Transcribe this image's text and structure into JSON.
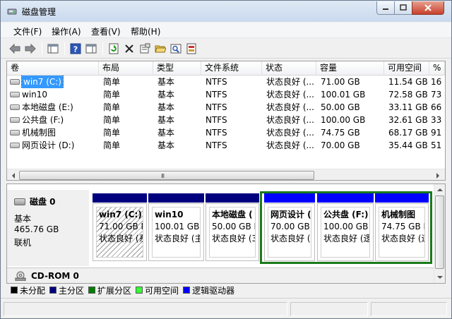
{
  "window": {
    "title": "磁盘管理"
  },
  "menu": [
    "文件(F)",
    "操作(A)",
    "查看(V)",
    "帮助(H)"
  ],
  "toolbar": {
    "icons": [
      "back-arrow-icon",
      "forward-arrow-icon",
      "console-tree-icon",
      "help-icon",
      "properties-panel-icon",
      "refresh-icon",
      "delete-icon",
      "properties-icon",
      "open-folder-icon",
      "search-icon",
      "rescan-disk-icon"
    ]
  },
  "columns": [
    "卷",
    "布局",
    "类型",
    "文件系统",
    "状态",
    "容量",
    "可用空间",
    "%"
  ],
  "volumes": [
    {
      "name": "win7 (C:)",
      "layout": "简单",
      "type": "基本",
      "fs": "NTFS",
      "status": "状态良好 (...",
      "capacity": "71.00 GB",
      "free": "11.54 GB",
      "pct": "16",
      "selected": true
    },
    {
      "name": "win10",
      "layout": "简单",
      "type": "基本",
      "fs": "NTFS",
      "status": "状态良好 (...",
      "capacity": "100.01 GB",
      "free": "72.58 GB",
      "pct": "73"
    },
    {
      "name": "本地磁盘 (E:)",
      "layout": "简单",
      "type": "基本",
      "fs": "NTFS",
      "status": "状态良好 (...",
      "capacity": "50.00 GB",
      "free": "33.11 GB",
      "pct": "66"
    },
    {
      "name": "公共盘 (F:)",
      "layout": "简单",
      "type": "基本",
      "fs": "NTFS",
      "status": "状态良好 (...",
      "capacity": "100.00 GB",
      "free": "32.61 GB",
      "pct": "33"
    },
    {
      "name": "机械制图",
      "layout": "简单",
      "type": "基本",
      "fs": "NTFS",
      "status": "状态良好 (...",
      "capacity": "74.75 GB",
      "free": "68.17 GB",
      "pct": "91"
    },
    {
      "name": "网页设计 (D:)",
      "layout": "简单",
      "type": "基本",
      "fs": "NTFS",
      "status": "状态良好 (...",
      "capacity": "70.00 GB",
      "free": "35.44 GB",
      "pct": "51"
    }
  ],
  "scroll": {
    "grip": "III"
  },
  "disk0": {
    "title": "磁盘 0",
    "kind": "基本",
    "size": "465.76 GB",
    "state": "联机",
    "partitions": [
      {
        "name": "win7  (C:)",
        "size": "71.00 GB N",
        "status": "状态良好 (系",
        "band": "primary"
      },
      {
        "name": "win10",
        "size": "100.01 GB I",
        "status": "状态良好 (主",
        "band": "primary"
      },
      {
        "name": "本地磁盘  (",
        "size": "50.00 GB N",
        "status": "状态良好 (3",
        "band": "primary"
      },
      {
        "name": "网页设计  (",
        "size": "70.00 GB I",
        "status": "状态良好 (注",
        "band": "logical"
      },
      {
        "name": "公共盘  (F:)",
        "size": "100.00 GB I",
        "status": "状态良好 (逻",
        "band": "logical"
      },
      {
        "name": "机械制图",
        "size": "74.75 GB N",
        "status": "状态良好 (逻",
        "band": "logical"
      }
    ]
  },
  "cdrom": {
    "title": "CD-ROM 0"
  },
  "legend": [
    {
      "label": "未分配",
      "color": "#000000"
    },
    {
      "label": "主分区",
      "color": "#00007f"
    },
    {
      "label": "扩展分区",
      "color": "#008000"
    },
    {
      "label": "可用空间",
      "color": "#33ff33"
    },
    {
      "label": "逻辑驱动器",
      "color": "#0000ff"
    }
  ],
  "colors": {
    "primary_band": "#00007f",
    "logical_band": "#0000ff",
    "extended_frame": "#1a7a1a",
    "selection": "#3399ff"
  }
}
